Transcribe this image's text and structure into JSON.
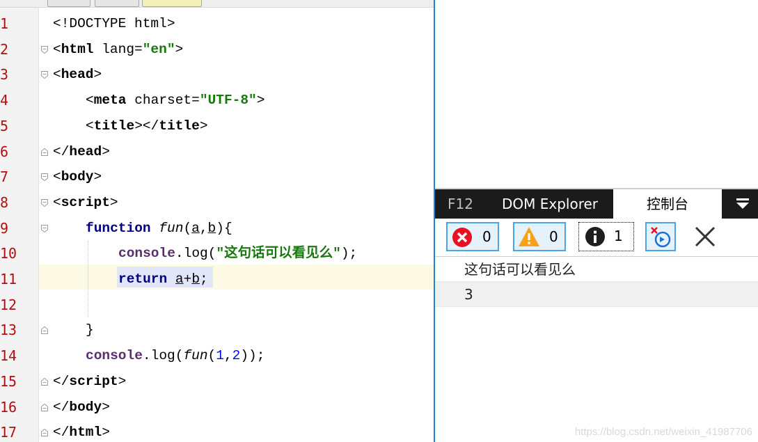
{
  "editor": {
    "line_numbers": [
      "1",
      "2",
      "3",
      "4",
      "5",
      "6",
      "7",
      "8",
      "9",
      "10",
      "11",
      "12",
      "13",
      "14",
      "15",
      "16",
      "17"
    ],
    "lines": [
      {
        "segs": [
          {
            "t": "<!DOCTYPE html>",
            "c": "plain"
          }
        ]
      },
      {
        "segs": [
          {
            "t": "<",
            "c": "plain"
          },
          {
            "t": "html",
            "c": "tag"
          },
          {
            "t": " lang=",
            "c": "plain"
          },
          {
            "t": "\"en\"",
            "c": "str"
          },
          {
            "t": ">",
            "c": "plain"
          }
        ]
      },
      {
        "segs": [
          {
            "t": "<",
            "c": "plain"
          },
          {
            "t": "head",
            "c": "tag"
          },
          {
            "t": ">",
            "c": "plain"
          }
        ]
      },
      {
        "segs": [
          {
            "t": "<",
            "c": "plain"
          },
          {
            "t": "meta",
            "c": "tag"
          },
          {
            "t": " charset=",
            "c": "plain"
          },
          {
            "t": "\"UTF-8\"",
            "c": "str"
          },
          {
            "t": ">",
            "c": "plain"
          }
        ]
      },
      {
        "segs": [
          {
            "t": "<",
            "c": "plain"
          },
          {
            "t": "title",
            "c": "tag"
          },
          {
            "t": "></",
            "c": "plain"
          },
          {
            "t": "title",
            "c": "tag"
          },
          {
            "t": ">",
            "c": "plain"
          }
        ]
      },
      {
        "segs": [
          {
            "t": "</",
            "c": "plain"
          },
          {
            "t": "head",
            "c": "tag"
          },
          {
            "t": ">",
            "c": "plain"
          }
        ]
      },
      {
        "segs": [
          {
            "t": "<",
            "c": "plain"
          },
          {
            "t": "body",
            "c": "tag"
          },
          {
            "t": ">",
            "c": "plain"
          }
        ]
      },
      {
        "segs": [
          {
            "t": "<",
            "c": "plain"
          },
          {
            "t": "script",
            "c": "tag"
          },
          {
            "t": ">",
            "c": "plain"
          }
        ]
      },
      {
        "segs": [
          {
            "t": "function",
            "c": "kw"
          },
          {
            "t": " ",
            "c": "plain"
          },
          {
            "t": "fun",
            "c": "fn"
          },
          {
            "t": "(",
            "c": "plain"
          },
          {
            "t": "a",
            "c": "u"
          },
          {
            "t": ",",
            "c": "plain"
          },
          {
            "t": "b",
            "c": "u"
          },
          {
            "t": "){",
            "c": "plain"
          }
        ]
      },
      {
        "segs": [
          {
            "t": "console",
            "c": "obj"
          },
          {
            "t": ".log(",
            "c": "plain"
          },
          {
            "t": "\"这句话可以看见么\"",
            "c": "str"
          },
          {
            "t": ");",
            "c": "plain"
          }
        ]
      },
      {
        "segs": [
          {
            "t": "return",
            "c": "kw"
          },
          {
            "t": " ",
            "c": "plain"
          },
          {
            "t": "a",
            "c": "u"
          },
          {
            "t": "+",
            "c": "plain"
          },
          {
            "t": "b",
            "c": "u"
          },
          {
            "t": ";",
            "c": "plain"
          }
        ]
      },
      {
        "segs": []
      },
      {
        "segs": [
          {
            "t": "}",
            "c": "plain"
          }
        ]
      },
      {
        "segs": [
          {
            "t": "console",
            "c": "obj"
          },
          {
            "t": ".log(",
            "c": "plain"
          },
          {
            "t": "fun",
            "c": "fn"
          },
          {
            "t": "(",
            "c": "plain"
          },
          {
            "t": "1",
            "c": "num"
          },
          {
            "t": ",",
            "c": "plain"
          },
          {
            "t": "2",
            "c": "num"
          },
          {
            "t": "));",
            "c": "plain"
          }
        ]
      },
      {
        "segs": [
          {
            "t": "</",
            "c": "plain"
          },
          {
            "t": "script",
            "c": "tag"
          },
          {
            "t": ">",
            "c": "plain"
          }
        ]
      },
      {
        "segs": [
          {
            "t": "</",
            "c": "plain"
          },
          {
            "t": "body",
            "c": "tag"
          },
          {
            "t": ">",
            "c": "plain"
          }
        ]
      },
      {
        "segs": [
          {
            "t": "</",
            "c": "plain"
          },
          {
            "t": "html",
            "c": "tag"
          },
          {
            "t": ">",
            "c": "plain"
          }
        ]
      }
    ]
  },
  "devtools": {
    "tabs": {
      "f12": "F12",
      "dom": "DOM Explorer",
      "console": "控制台"
    },
    "errors_count": "0",
    "warnings_count": "0",
    "info_count": "1",
    "messages": [
      "这句话可以看见么",
      "3"
    ]
  },
  "watermark": "https://blog.csdn.net/weixin_41987706",
  "colors": {
    "accent": "#1f84d6",
    "string": "#16780d",
    "keyword": "#000080",
    "line_number": "#b30d0d"
  }
}
